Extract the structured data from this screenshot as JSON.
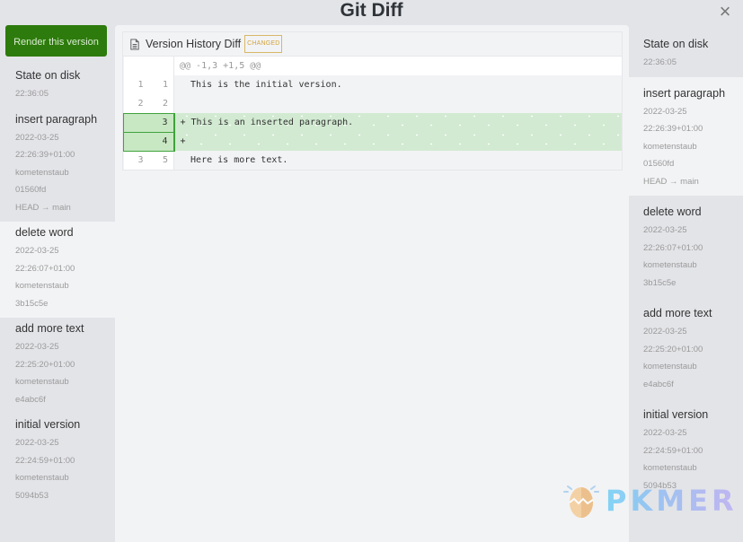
{
  "window": {
    "title": "Git Diff",
    "close_label": "×"
  },
  "left_panel": {
    "render_button_label": "Render this version",
    "versions": [
      {
        "title": "State on disk",
        "meta": [
          "22:36:05"
        ]
      },
      {
        "title": "insert paragraph",
        "meta": [
          "2022-03-25",
          "22:26:39+01:00",
          "kometenstaub",
          "01560fd",
          "HEAD → main"
        ]
      },
      {
        "title": "delete word",
        "meta": [
          "2022-03-25",
          "22:26:07+01:00",
          "kometenstaub",
          "3b15c5e"
        ],
        "selected": true
      },
      {
        "title": "add more text",
        "meta": [
          "2022-03-25",
          "22:25:20+01:00",
          "kometenstaub",
          "e4abc6f"
        ]
      },
      {
        "title": "initial version",
        "meta": [
          "2022-03-25",
          "22:24:59+01:00",
          "kometenstaub",
          "5094b53"
        ]
      }
    ]
  },
  "right_panel": {
    "versions": [
      {
        "title": "State on disk",
        "meta": [
          "22:36:05"
        ]
      },
      {
        "title": "insert paragraph",
        "meta": [
          "2022-03-25",
          "22:26:39+01:00",
          "kometenstaub",
          "01560fd",
          "HEAD → main"
        ],
        "selected": true
      },
      {
        "title": "delete word",
        "meta": [
          "2022-03-25",
          "22:26:07+01:00",
          "kometenstaub",
          "3b15c5e"
        ]
      },
      {
        "title": "add more text",
        "meta": [
          "2022-03-25",
          "22:25:20+01:00",
          "kometenstaub",
          "e4abc6f"
        ]
      },
      {
        "title": "initial version",
        "meta": [
          "2022-03-25",
          "22:24:59+01:00",
          "kometenstaub",
          "5094b53"
        ]
      }
    ]
  },
  "diff": {
    "file_icon": "file-text-icon",
    "filename": "Version History Diff",
    "badge": "CHANGED",
    "colors": {
      "insert_bg": "#d2ead2",
      "insert_border": "#3fa33b",
      "badge": "#d3a53f",
      "button": "#2d7b0c"
    },
    "hunk_header": "@@ -1,3 +1,5 @@",
    "lines": [
      {
        "type": "ctx",
        "old": "1",
        "new": "1",
        "text": "  This is the initial version."
      },
      {
        "type": "ctx",
        "old": "2",
        "new": "2",
        "text": ""
      },
      {
        "type": "ins",
        "old": "",
        "new": "3",
        "text": "+ This is an inserted paragraph."
      },
      {
        "type": "ins",
        "old": "",
        "new": "4",
        "text": "+"
      },
      {
        "type": "ctx",
        "old": "3",
        "new": "5",
        "text": "  Here is more text."
      }
    ]
  },
  "watermark": {
    "text": "PKMER"
  }
}
